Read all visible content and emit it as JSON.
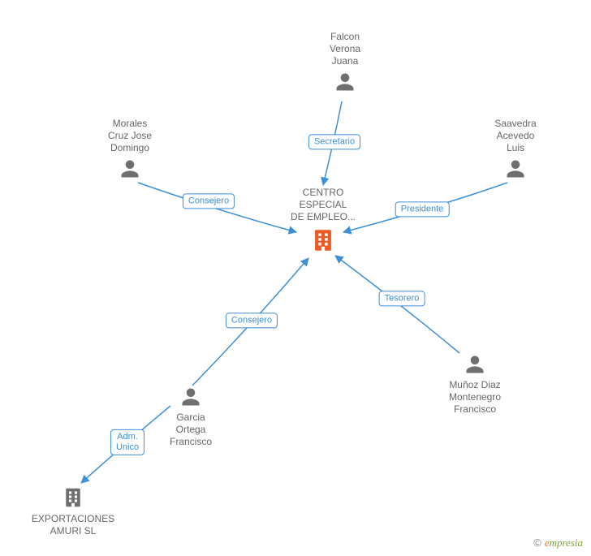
{
  "center": {
    "label": "CENTRO\nESPECIAL\nDE EMPLEO..."
  },
  "nodes": {
    "falcon": {
      "label": "Falcon\nVerona\nJuana"
    },
    "saavedra": {
      "label": "Saavedra\nAcevedo\nLuis"
    },
    "munoz": {
      "label": "Muñoz Diaz\nMontenegro\nFrancisco"
    },
    "garcia": {
      "label": "Garcia\nOrtega\nFrancisco"
    },
    "morales": {
      "label": "Morales\nCruz Jose\nDomingo"
    },
    "export": {
      "label": "EXPORTACIONES\nAMURI SL"
    }
  },
  "edges": {
    "secretario": {
      "label": "Secretario"
    },
    "presidente": {
      "label": "Presidente"
    },
    "tesorero": {
      "label": "Tesorero"
    },
    "consejero_garcia": {
      "label": "Consejero"
    },
    "consejero_morales": {
      "label": "Consejero"
    },
    "adm_unico": {
      "label": "Adm.\nUnico"
    }
  },
  "watermark": {
    "copyright": "©",
    "brand_e": "e",
    "brand_rest": "mpresia"
  },
  "colors": {
    "edge": "#3d8fd6",
    "person": "#6f6f6f",
    "center_company": "#ef5a24",
    "other_company": "#6f6f6f"
  }
}
